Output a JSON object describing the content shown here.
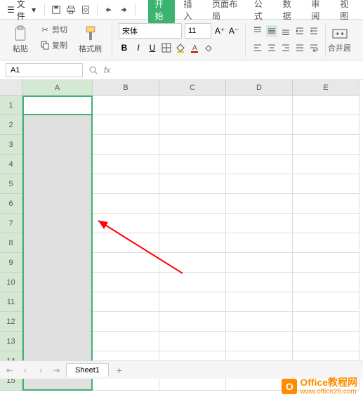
{
  "menu": {
    "file": "文件",
    "tabs": [
      "开始",
      "插入",
      "页面布局",
      "公式",
      "数据",
      "审阅",
      "视图"
    ]
  },
  "ribbon": {
    "cut": "剪切",
    "copy": "复制",
    "paste": "粘贴",
    "format_painter": "格式刷",
    "font_name": "宋体",
    "font_size": "11",
    "merge": "合并居"
  },
  "name_box": "A1",
  "columns": [
    "A",
    "B",
    "C",
    "D",
    "E"
  ],
  "rows": [
    "1",
    "2",
    "3",
    "4",
    "5",
    "6",
    "7",
    "8",
    "9",
    "10",
    "11",
    "12",
    "13",
    "14",
    "15"
  ],
  "sheet": {
    "active": "Sheet1"
  },
  "watermark": {
    "title": "Office教程网",
    "url": "www.office26.com"
  }
}
